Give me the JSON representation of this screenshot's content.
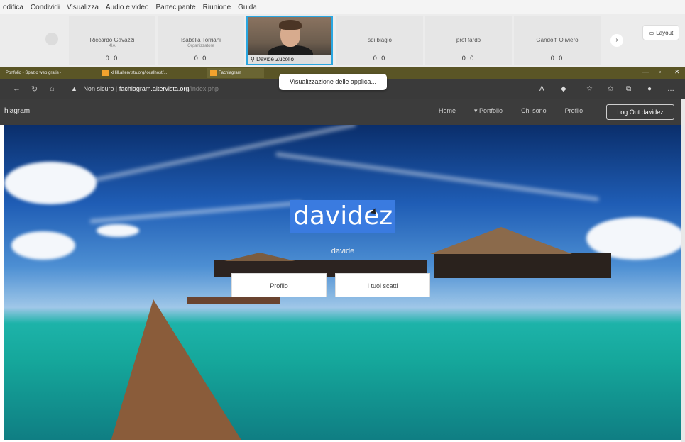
{
  "menubar": [
    "odifica",
    "Condividi",
    "Visualizza",
    "Audio e video",
    "Partecipante",
    "Riunione",
    "Guida"
  ],
  "participants": [
    {
      "name": "Riccardo Gavazzi",
      "role": "4IA",
      "mic": "0 0"
    },
    {
      "name": "Isabella Torriani",
      "role": "Organizzatore",
      "mic": "0 0"
    },
    {
      "name": "Davide Zucollo",
      "mic": "",
      "video": true
    },
    {
      "name": "sdi biagio",
      "mic": "0 0"
    },
    {
      "name": "prof fardo",
      "mic": "0 0"
    },
    {
      "name": "Gandolfi Oliviero",
      "mic": "0 0"
    }
  ],
  "layout_label": "Layout",
  "tabs": [
    {
      "label": "Portfolio - Spazio web gratis ·"
    },
    {
      "label": "xHill.altervista.org/localhost/..."
    },
    {
      "label": "Fachiagram"
    },
    {
      "label": "Visualizzazione delle applica..."
    }
  ],
  "address": {
    "warning": "Non sicuro",
    "host": "fachiagram.altervista.org",
    "path": "/index.php"
  },
  "tooltip": "Visualizzazione delle applica...",
  "site": {
    "brand": "hiagram",
    "nav": [
      "Home",
      "▾ Portfolio",
      "Chi sono",
      "Profilo"
    ],
    "logout": "Log Out davidez"
  },
  "hero": {
    "title": "davidez",
    "subtitle": "davide",
    "btn_profile": "Profilo",
    "btn_photos": "I tuoi scatti"
  }
}
